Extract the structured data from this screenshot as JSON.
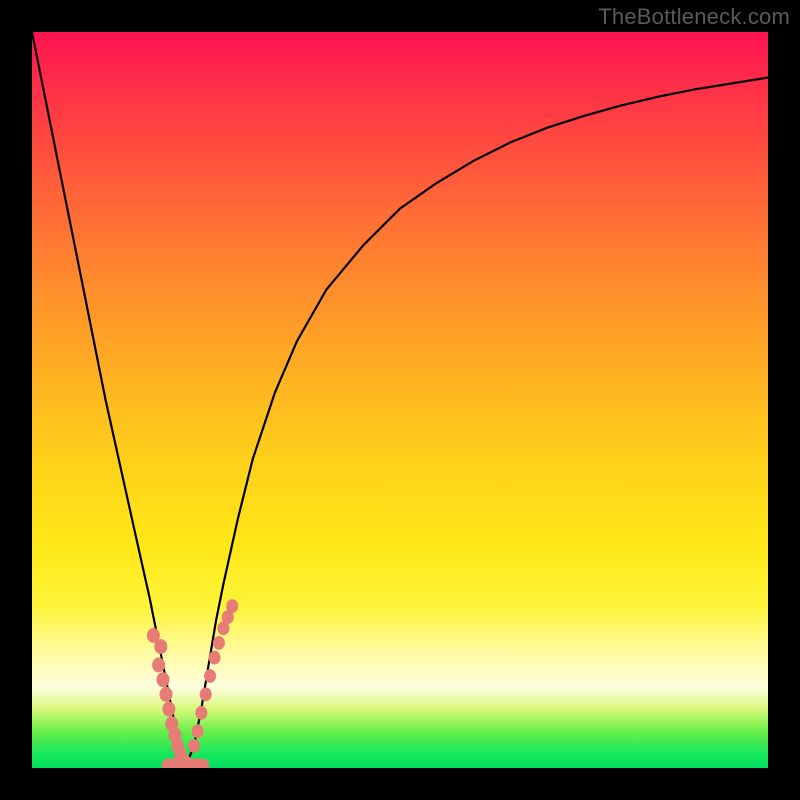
{
  "watermark": "TheBottleneck.com",
  "colors": {
    "frame": "#000000",
    "curve": "#000000",
    "marker": "#e77c76",
    "gradient_top": "#ff1450",
    "gradient_bottom": "#00e060"
  },
  "chart_data": {
    "type": "line",
    "title": "",
    "xlabel": "",
    "ylabel": "",
    "xlim": [
      0,
      100
    ],
    "ylim": [
      0,
      100
    ],
    "x": [
      0,
      2,
      4,
      6,
      8,
      10,
      12,
      14,
      16,
      18,
      19,
      20,
      20.5,
      21,
      22,
      23,
      24,
      25,
      26,
      28,
      30,
      33,
      36,
      40,
      45,
      50,
      55,
      60,
      65,
      70,
      75,
      80,
      85,
      90,
      95,
      100
    ],
    "y": [
      100,
      90,
      80,
      70,
      60,
      50,
      41,
      32,
      23,
      13,
      8,
      3,
      0.5,
      0.5,
      3,
      8,
      14,
      20,
      25,
      34,
      42,
      51,
      58,
      65,
      71,
      76,
      79.5,
      82.5,
      85,
      87,
      88.6,
      90,
      91.2,
      92.2,
      93,
      93.8
    ],
    "markers_left": {
      "x": [
        16.5,
        17.5,
        17.2,
        17.8,
        18.2,
        18.6,
        19.0,
        19.4,
        19.8,
        20.2,
        20.6,
        21.0
      ],
      "y": [
        18,
        16.5,
        14,
        12,
        10,
        8,
        6,
        4.5,
        3,
        1.8,
        1,
        0.6
      ]
    },
    "markers_right": {
      "x": [
        22.0,
        22.5,
        23.0,
        23.6,
        24.2,
        24.8,
        25.4,
        26.0,
        26.6,
        27.2
      ],
      "y": [
        3,
        5,
        7.5,
        10,
        12.5,
        15,
        17,
        19,
        20.5,
        22
      ]
    },
    "floor_cluster": {
      "x": [
        18.5,
        19.3,
        20.0,
        20.8,
        21.6,
        22.4,
        23.2
      ],
      "y": [
        0.3,
        0.3,
        0.3,
        0.3,
        0.3,
        0.3,
        0.3
      ]
    }
  }
}
